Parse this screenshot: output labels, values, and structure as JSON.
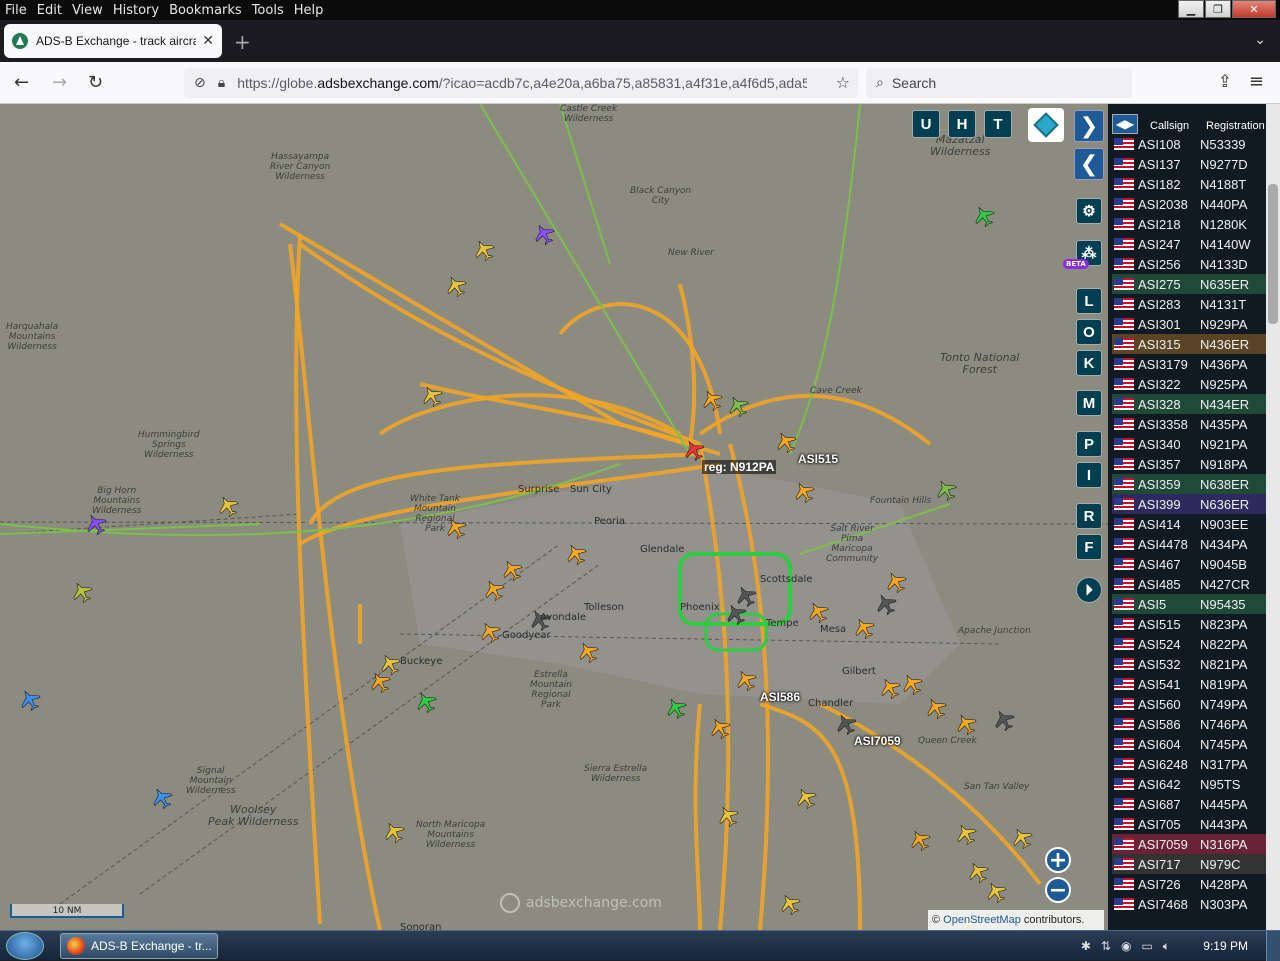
{
  "menubar": {
    "items": [
      "File",
      "Edit",
      "View",
      "History",
      "Bookmarks",
      "Tools",
      "Help"
    ]
  },
  "tab": {
    "title": "ADS-B Exchange - track aircraft",
    "close": "✕"
  },
  "toolbar": {
    "url_prefix": "https://globe.",
    "url_domain": "adsbexchange.com",
    "url_rest": "/?icao=acdb7c,a4e20a,a6ba75,a85831,a4f31e,a4f6d5,ada546,",
    "search_placeholder": "Search"
  },
  "map": {
    "labels": [
      {
        "text": "Hassayampa\nRiver Canyon\nWilderness"
      },
      {
        "text": "Castle Creek\nWilderness"
      },
      {
        "text": "Mazatzal\nWilderness"
      },
      {
        "text": "Black Canyon\nCity"
      },
      {
        "text": "New River"
      },
      {
        "text": "Cave Creek"
      },
      {
        "text": "Harquahala\nMountains\nWilderness"
      },
      {
        "text": "Hummingbird\nSprings\nWilderness"
      },
      {
        "text": "Big Horn\nMountains\nWilderness"
      },
      {
        "text": "White Tank\nMountain\nRegional\nPark"
      },
      {
        "text": "Tonto National\nForest"
      },
      {
        "text": "Salt River\nPima\nMaricopa\nCommunity"
      },
      {
        "text": "Fountain Hills"
      },
      {
        "text": "Estrella\nMountain\nRegional\nPark"
      },
      {
        "text": "Signal\nMountain\nWilderness"
      },
      {
        "text": "Woolsey\nPeak Wilderness"
      },
      {
        "text": "North Maricopa\nMountains\nWilderness"
      },
      {
        "text": "Sierra Estrella\nWilderness"
      },
      {
        "text": "San Tan Valley"
      },
      {
        "text": "Queen Creek"
      },
      {
        "text": "Apache Junction"
      }
    ],
    "cities": [
      "Surprise",
      "Sun City",
      "Peoria",
      "Tolleson",
      "Goodyear",
      "Avondale",
      "Buckeye",
      "Phoenix",
      "Tempe",
      "Mesa",
      "Gilbert",
      "Chandler",
      "Scottsdale",
      "Glendale",
      "Sonoran"
    ],
    "aircraft_labels": [
      "reg: N912PA",
      "ASI515",
      "ASI586",
      "ASI7059"
    ],
    "scale": "10 NM",
    "watermark": "adsbexchange.com",
    "attribution_prefix": "© ",
    "attribution_link": "OpenStreetMap",
    "attribution_suffix": " contributors.",
    "route_color": "#f5a623",
    "accent_color": "#1e5a95"
  },
  "controls": {
    "top_buttons": [
      "U",
      "H",
      "T"
    ],
    "side_buttons": [
      "L",
      "O",
      "K",
      "M",
      "P",
      "I",
      "R",
      "F"
    ],
    "beta_badge": "BETA",
    "zoom_in": "+",
    "zoom_out": "−"
  },
  "table": {
    "headers": [
      "Callsign",
      "Registration"
    ],
    "rows": [
      {
        "callsign": "ASI108",
        "reg": "N53339",
        "bg": ""
      },
      {
        "callsign": "ASI137",
        "reg": "N9277D",
        "bg": ""
      },
      {
        "callsign": "ASI182",
        "reg": "N4188T",
        "bg": ""
      },
      {
        "callsign": "ASI2038",
        "reg": "N440PA",
        "bg": ""
      },
      {
        "callsign": "ASI218",
        "reg": "N1280K",
        "bg": ""
      },
      {
        "callsign": "ASI247",
        "reg": "N4140W",
        "bg": ""
      },
      {
        "callsign": "ASI256",
        "reg": "N4133D",
        "bg": ""
      },
      {
        "callsign": "ASI275",
        "reg": "N635ER",
        "bg": "#1f4a3a"
      },
      {
        "callsign": "ASI283",
        "reg": "N4131T",
        "bg": ""
      },
      {
        "callsign": "ASI301",
        "reg": "N929PA",
        "bg": ""
      },
      {
        "callsign": "ASI315",
        "reg": "N436ER",
        "bg": "#5a4424"
      },
      {
        "callsign": "ASI3179",
        "reg": "N436PA",
        "bg": ""
      },
      {
        "callsign": "ASI322",
        "reg": "N925PA",
        "bg": ""
      },
      {
        "callsign": "ASI328",
        "reg": "N434ER",
        "bg": "#1f4a3a"
      },
      {
        "callsign": "ASI3358",
        "reg": "N435PA",
        "bg": ""
      },
      {
        "callsign": "ASI340",
        "reg": "N921PA",
        "bg": ""
      },
      {
        "callsign": "ASI357",
        "reg": "N918PA",
        "bg": ""
      },
      {
        "callsign": "ASI359",
        "reg": "N638ER",
        "bg": "#1f4a3a"
      },
      {
        "callsign": "ASI399",
        "reg": "N636ER",
        "bg": "#2c2a5e"
      },
      {
        "callsign": "ASI414",
        "reg": "N903EE",
        "bg": ""
      },
      {
        "callsign": "ASI4478",
        "reg": "N434PA",
        "bg": ""
      },
      {
        "callsign": "ASI467",
        "reg": "N9045B",
        "bg": ""
      },
      {
        "callsign": "ASI485",
        "reg": "N427CR",
        "bg": ""
      },
      {
        "callsign": "ASI5",
        "reg": "N95435",
        "bg": "#1f4a3a"
      },
      {
        "callsign": "ASI515",
        "reg": "N823PA",
        "bg": ""
      },
      {
        "callsign": "ASI524",
        "reg": "N822PA",
        "bg": ""
      },
      {
        "callsign": "ASI532",
        "reg": "N821PA",
        "bg": ""
      },
      {
        "callsign": "ASI541",
        "reg": "N819PA",
        "bg": ""
      },
      {
        "callsign": "ASI560",
        "reg": "N749PA",
        "bg": ""
      },
      {
        "callsign": "ASI586",
        "reg": "N746PA",
        "bg": ""
      },
      {
        "callsign": "ASI604",
        "reg": "N745PA",
        "bg": ""
      },
      {
        "callsign": "ASI6248",
        "reg": "N317PA",
        "bg": ""
      },
      {
        "callsign": "ASI642",
        "reg": "N95TS",
        "bg": ""
      },
      {
        "callsign": "ASI687",
        "reg": "N445PA",
        "bg": ""
      },
      {
        "callsign": "ASI705",
        "reg": "N443PA",
        "bg": ""
      },
      {
        "callsign": "ASI7059",
        "reg": "N316PA",
        "bg": "#6a2236"
      },
      {
        "callsign": "ASI717",
        "reg": "N979C",
        "bg": "#333333"
      },
      {
        "callsign": "ASI726",
        "reg": "N428PA",
        "bg": ""
      },
      {
        "callsign": "ASI7468",
        "reg": "N303PA",
        "bg": ""
      }
    ]
  },
  "taskbar": {
    "app_label": "ADS-B Exchange - tr...",
    "time": "9:19 PM"
  }
}
